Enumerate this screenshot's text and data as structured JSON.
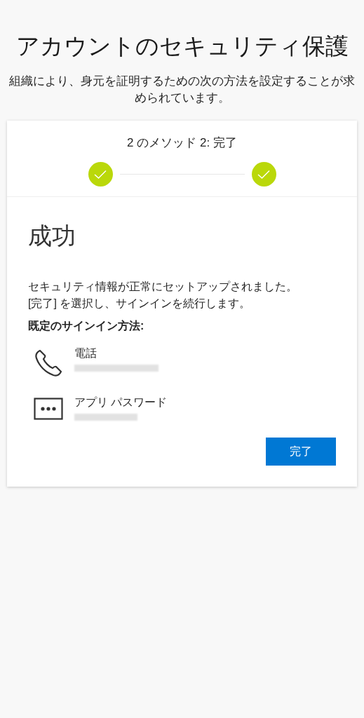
{
  "title": "アカウントのセキュリティ保護",
  "subtitle": "組織により、身元を証明するための次の方法を設定することが求められています。",
  "progress": {
    "label": "2 のメソッド 2: 完了",
    "steps": [
      {
        "completed": true
      },
      {
        "completed": true
      }
    ]
  },
  "heading": "成功",
  "message_lines": [
    "セキュリティ情報が正常にセットアップされました。",
    "[完了] を選択し、サインインを続行します。"
  ],
  "methods_label": "既定のサインイン方法:",
  "methods": [
    {
      "kind": "phone",
      "name": "電話",
      "redacted": true
    },
    {
      "kind": "password",
      "name": "アプリ パスワード",
      "redacted": true
    }
  ],
  "done_button": "完了"
}
